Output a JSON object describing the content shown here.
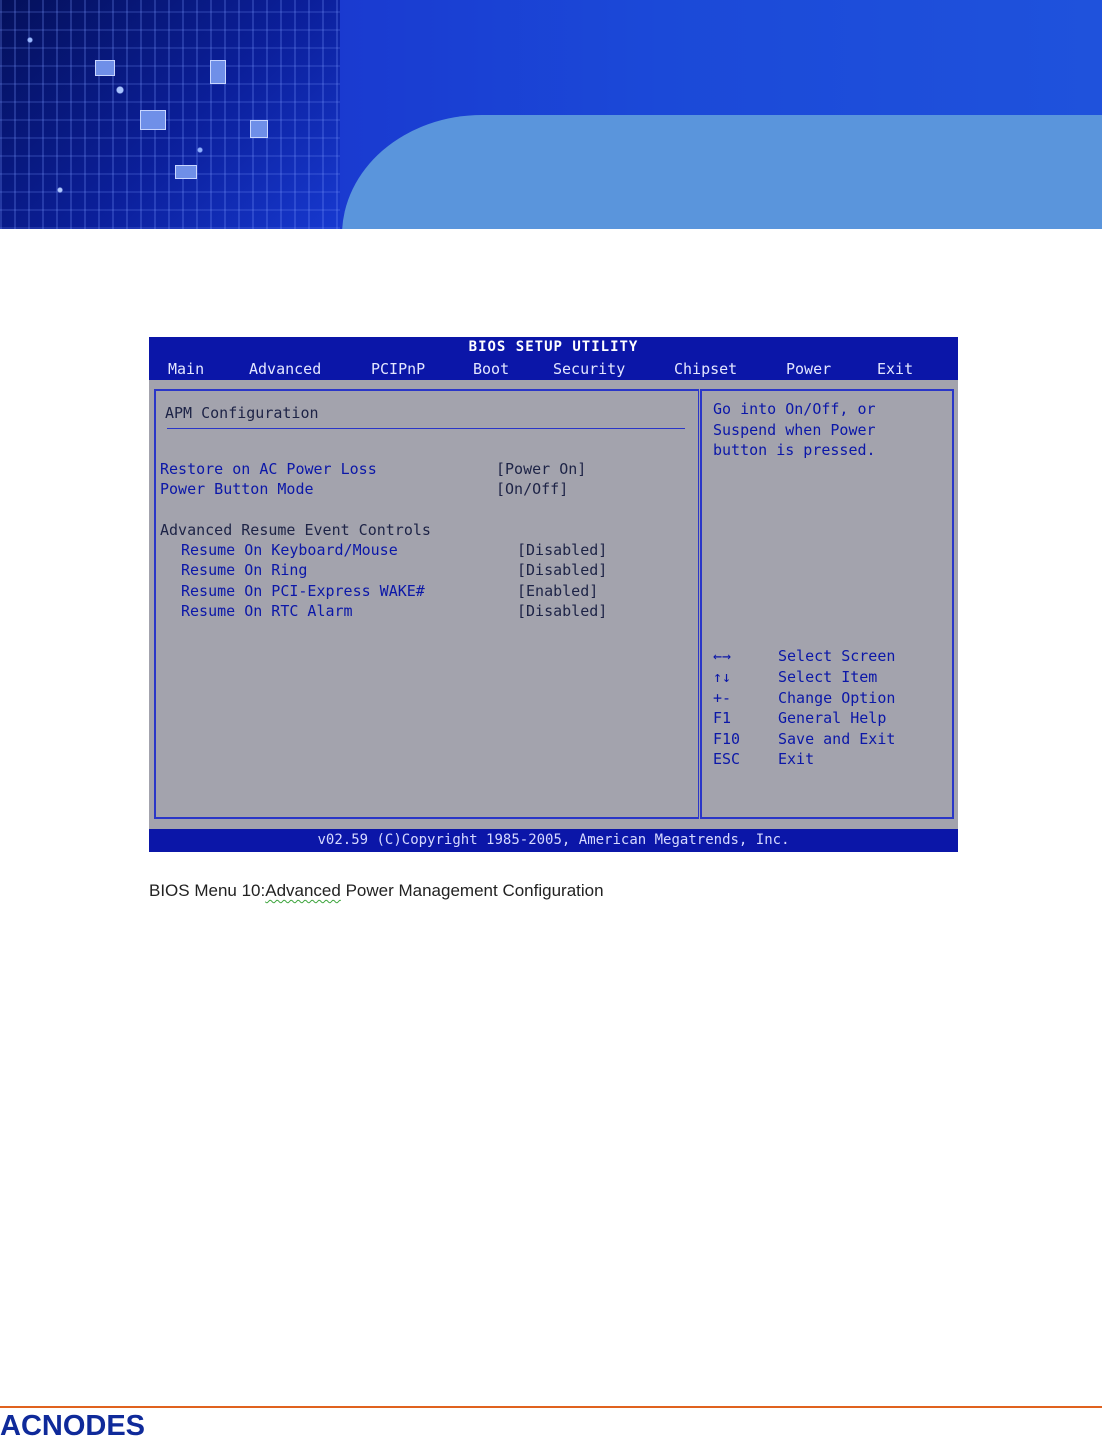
{
  "bios": {
    "title": "BIOS SETUP UTILITY",
    "tabs": [
      "Main",
      "Advanced",
      "PCIPnP",
      "Boot",
      "Security",
      "Chipset",
      "Power",
      "Exit"
    ],
    "section_title": "APM Configuration",
    "items": [
      {
        "label": "Restore on AC Power Loss",
        "value": "[Power On]"
      },
      {
        "label": "Power Button Mode",
        "value": "[On/Off]"
      }
    ],
    "group_title": "Advanced Resume Event Controls",
    "sub_items": [
      {
        "label": "Resume On Keyboard/Mouse",
        "value": "[Disabled]"
      },
      {
        "label": "Resume On Ring",
        "value": "[Disabled]"
      },
      {
        "label": "Resume On PCI-Express WAKE#",
        "value": "[Enabled]"
      },
      {
        "label": "Resume On RTC Alarm",
        "value": "[Disabled]"
      }
    ],
    "help_lines": [
      "Go into On/Off, or",
      "Suspend when Power",
      "button is pressed."
    ],
    "keys": [
      {
        "key": "←→",
        "desc": "Select Screen"
      },
      {
        "key": "↑↓",
        "desc": "Select Item"
      },
      {
        "key": "+-",
        "desc": "Change Option"
      },
      {
        "key": "F1",
        "desc": "General Help"
      },
      {
        "key": "F10",
        "desc": "Save and Exit"
      },
      {
        "key": "ESC",
        "desc": "Exit"
      }
    ],
    "footer": "v02.59 (C)Copyright 1985-2005, American Megatrends, Inc."
  },
  "caption": {
    "prefix": "BIOS Menu 10:",
    "word": "Advanced",
    "suffix": " Power Management Configuration"
  },
  "brand": {
    "logo_text": "ACNODES"
  },
  "colors": {
    "bios_blue": "#0b16a8",
    "bios_gray": "#a3a3ad",
    "accent_orange": "#e0621e"
  }
}
